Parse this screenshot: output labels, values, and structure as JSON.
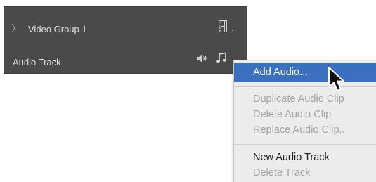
{
  "timeline": {
    "video_group_label": "Video Group 1",
    "audio_track_label": "Audio Track"
  },
  "icons": {
    "expand": "chevron-right-icon",
    "film": "film-strip-icon",
    "speaker": "speaker-icon",
    "note": "music-note-icon",
    "dropdown": "chevron-down-icon"
  },
  "menu": {
    "items": [
      {
        "label": "Add Audio...",
        "state": "highlighted"
      },
      {
        "label": "Duplicate Audio Clip",
        "state": "disabled"
      },
      {
        "label": "Delete Audio Clip",
        "state": "disabled"
      },
      {
        "label": "Replace Audio Clip...",
        "state": "disabled"
      },
      {
        "label": "New Audio Track",
        "state": "enabled"
      },
      {
        "label": "Delete Track",
        "state": "disabled"
      }
    ]
  },
  "colors": {
    "panel": "#4a4a4a",
    "menu_bg": "#ececec",
    "highlight": "#3c6fbd",
    "disabled_text": "#a5a5a5"
  }
}
